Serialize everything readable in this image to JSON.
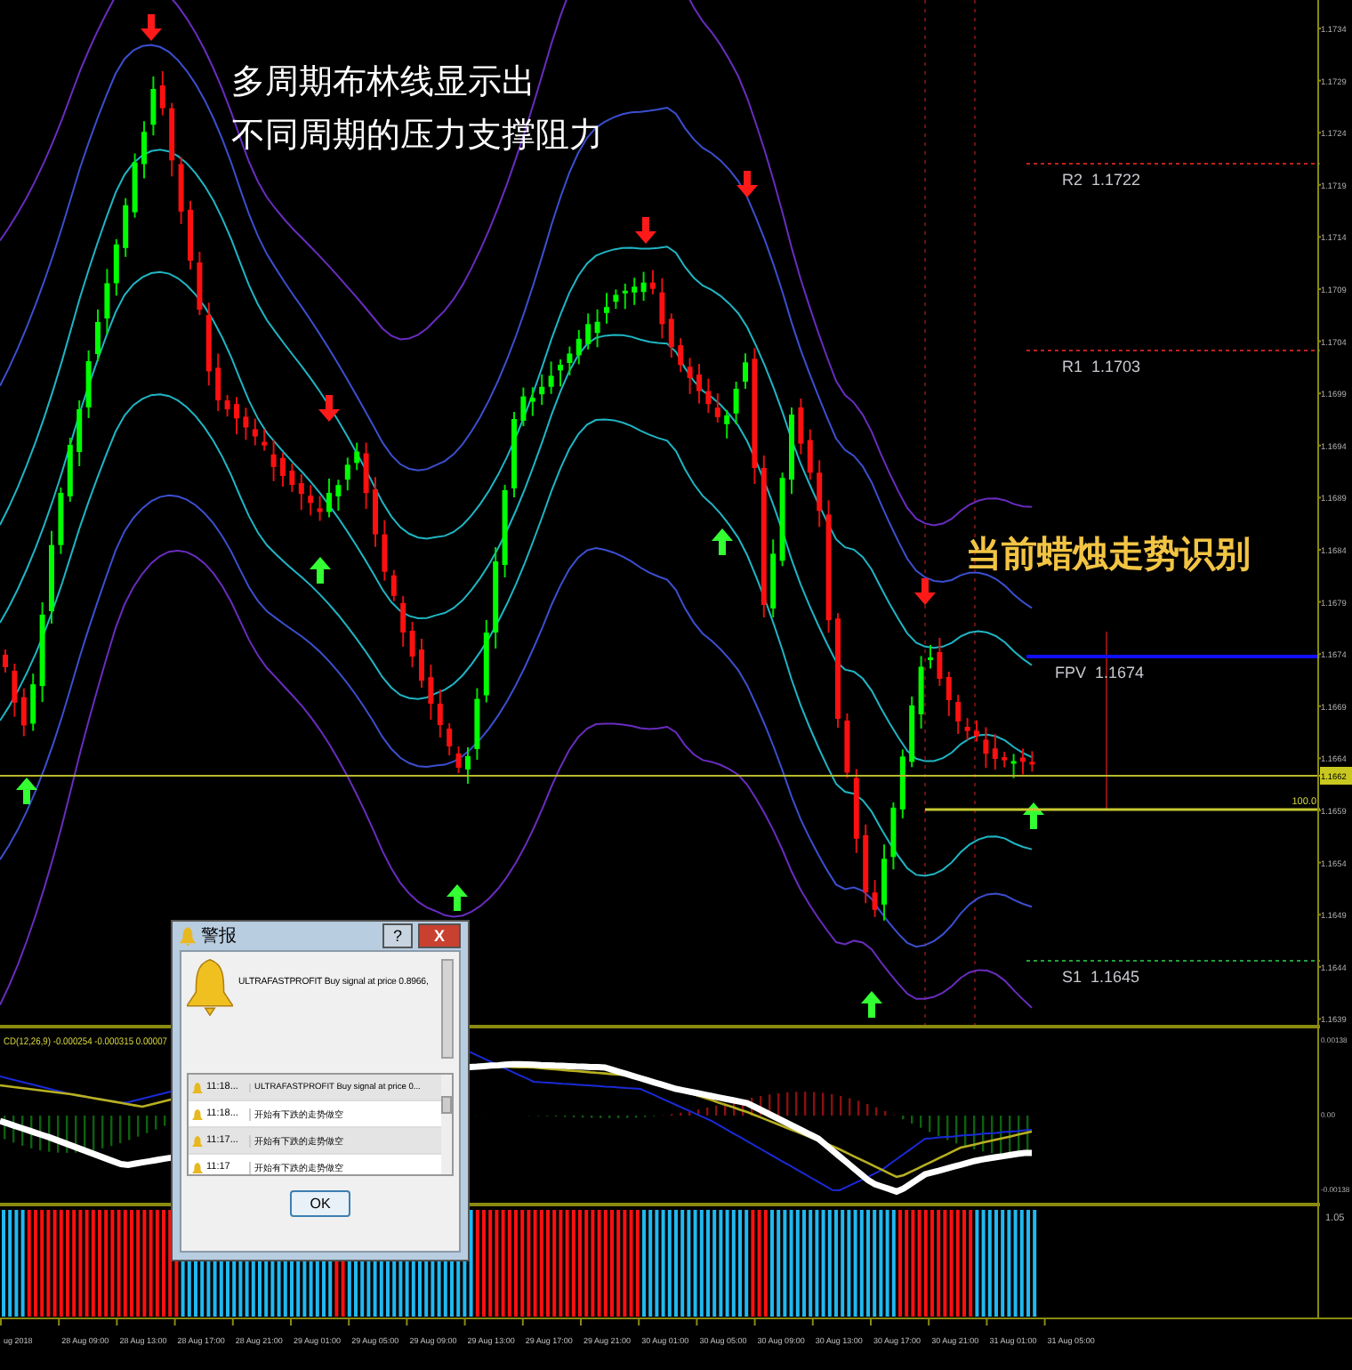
{
  "annotations": [
    {
      "text": "多周期布林线显示出",
      "kind": "note"
    },
    {
      "text": "不同周期的压力支撑阻力",
      "kind": "note"
    },
    {
      "text": "当前蜡烛走势识别",
      "kind": "highlight"
    }
  ],
  "price_axis": [
    "1.1734",
    "1.1729",
    "1.1724",
    "1.1719",
    "1.1714",
    "1.1709",
    "1.1704",
    "1.1699",
    "1.1694",
    "1.1689",
    "1.1684",
    "1.1679",
    "1.1674",
    "1.1669",
    "1.1664",
    "1.1659",
    "1.1654",
    "1.1649",
    "1.1644",
    "1.1639"
  ],
  "current_price": "1.1662",
  "level_lines": [
    {
      "name": "R2",
      "value": "1.1722",
      "kind": "resistance"
    },
    {
      "name": "R1",
      "value": "1.1703",
      "kind": "resistance"
    },
    {
      "name": "FPV",
      "value": "1.1674",
      "kind": "pivot"
    },
    {
      "name": "S1",
      "value": "1.1645",
      "kind": "support"
    }
  ],
  "target_label": "100.0",
  "macd": {
    "label": "CD(12,26,9) -0.000254 -0.000315 0.00007",
    "ticks": [
      "0.00138",
      "0.00",
      "-0.00138"
    ]
  },
  "histogram_panel": {
    "tick": "1.05"
  },
  "time_axis": [
    "ug 2018",
    "28 Aug 09:00",
    "28 Aug 13:00",
    "28 Aug 17:00",
    "28 Aug 21:00",
    "29 Aug 01:00",
    "29 Aug 05:00",
    "29 Aug 09:00",
    "29 Aug 13:00",
    "29 Aug 17:00",
    "29 Aug 21:00",
    "30 Aug 01:00",
    "30 Aug 05:00",
    "30 Aug 09:00",
    "30 Aug 13:00",
    "30 Aug 17:00",
    "30 Aug 21:00",
    "31 Aug 01:00",
    "31 Aug 05:00"
  ],
  "alert_dialog": {
    "title": "警报",
    "help": "?",
    "close": "X",
    "message": "ULTRAFASTPROFIT Buy signal at price 0.8966,",
    "rows": [
      {
        "time": "11:18...",
        "text": "ULTRAFASTPROFIT Buy signal at price 0..."
      },
      {
        "time": "11:18...",
        "text": "开始有下跌的走势做空"
      },
      {
        "time": "11:17...",
        "text": "开始有下跌的走势做空"
      },
      {
        "time": "11:17",
        "text": "开始有下跌的走势做空"
      }
    ],
    "ok": "OK"
  }
}
